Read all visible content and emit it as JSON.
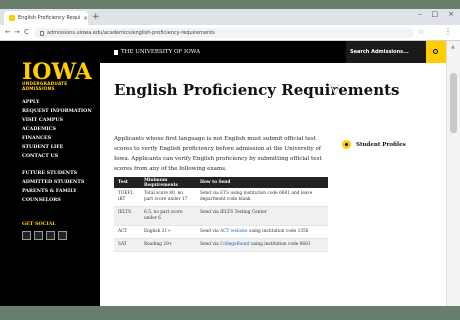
{
  "browser": {
    "tab_title": "English Proficiency Requireme",
    "tab_close": "×",
    "new_tab": "+",
    "back": "←",
    "forward": "→",
    "reload": "C",
    "url": "admissions.uiowa.edu/academics/english-proficiency-requirements",
    "star": "☆",
    "menu": "⋮",
    "window_controls": [
      "–",
      "□",
      "×"
    ]
  },
  "sidebar": {
    "logo": "IOWA",
    "logo_sub": "UNDERGRADUATE ADMISSIONS",
    "menu_primary": [
      "APPLY",
      "REQUEST INFORMATION",
      "VISIT CAMPUS",
      "ACADEMICS",
      "FINANCES",
      "STUDENT LIFE",
      "CONTACT US"
    ],
    "menu_secondary": [
      "FUTURE STUDENTS",
      "ADMITTED STUDENTS",
      "PARENTS & FAMILY",
      "COUNSELORS"
    ],
    "social_label": "GET SOCIAL",
    "social_icons": [
      "facebook-icon",
      "twitter-icon",
      "youtube-icon",
      "instagram-icon"
    ]
  },
  "header": {
    "brand": "THE UNIVERSITY OF IOWA",
    "search_label": "Search Admissions..."
  },
  "main": {
    "title": "English Proficiency Requirements",
    "title_ghost": "V",
    "intro": "Applicants whose first language is not English must submit official test scores to verify English proficiency before admission at the University of Iowa. Applicants can verify English proficiency by submitting official test scores from any of the following exams.",
    "profiles_label": "Student Profiles"
  },
  "table": {
    "headers": [
      "Test",
      "Minimum Requirements",
      "How to Send"
    ],
    "rows": [
      {
        "test": "TOEFL iBT",
        "minimum": "Total score 80, no part score under 17",
        "send_pre": "Send via ",
        "send_link": "ETS",
        "send_post": " using institution code 6681 and leave department code blank"
      },
      {
        "test": "IELTS",
        "minimum": "6.5, no part score under 6",
        "send_pre": "Send via IELTS Testing Center",
        "send_link": "",
        "send_post": ""
      },
      {
        "test": "ACT",
        "minimum": "English 21+",
        "send_pre": "Send via ",
        "send_link": "ACT website",
        "send_post": " using institution code 1356"
      },
      {
        "test": "SAT",
        "minimum": "Reading 29+",
        "send_pre": "Send via ",
        "send_link": "CollegeBoard",
        "send_post": " using institution code 6681"
      }
    ]
  },
  "colors": {
    "brand_gold": "#ffcd00",
    "black": "#000000",
    "link": "#1a5fb4"
  }
}
